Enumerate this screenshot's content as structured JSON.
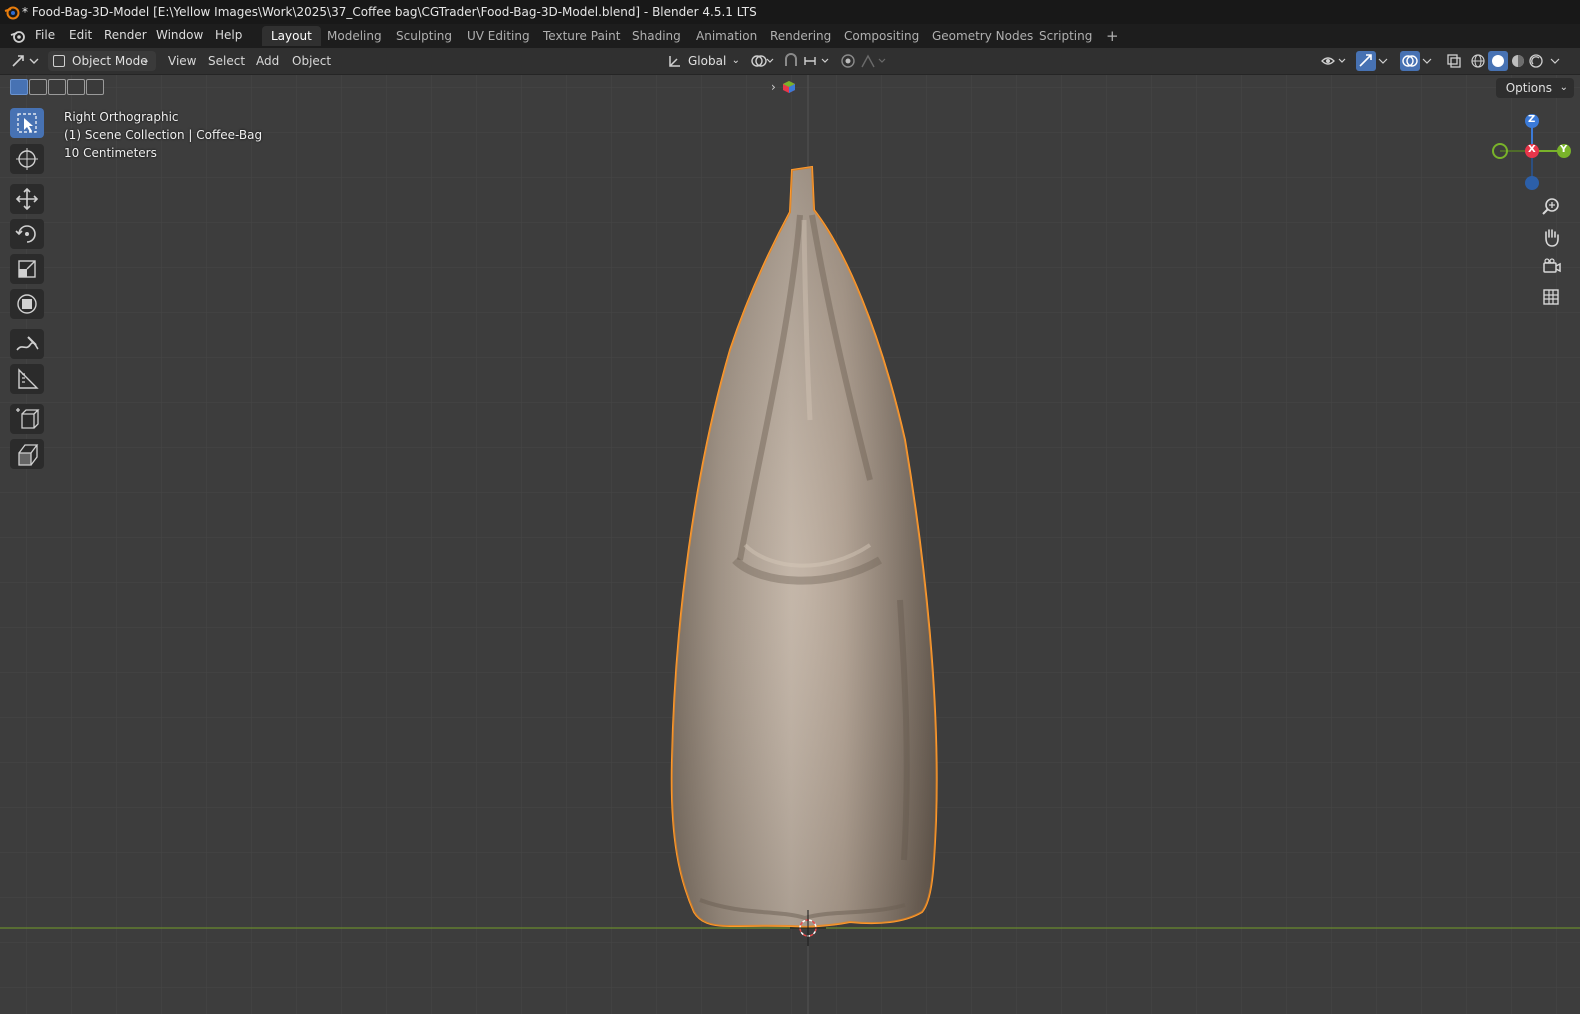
{
  "window": {
    "title": "* Food-Bag-3D-Model [E:\\Yellow Images\\Work\\2025\\37_Coffee bag\\CGTrader\\Food-Bag-3D-Model.blend] - Blender 4.5.1 LTS"
  },
  "menu": {
    "items": [
      "File",
      "Edit",
      "Render",
      "Window",
      "Help"
    ]
  },
  "workspaces": {
    "tabs": [
      "Layout",
      "Modeling",
      "Sculpting",
      "UV Editing",
      "Texture Paint",
      "Shading",
      "Animation",
      "Rendering",
      "Compositing",
      "Geometry Nodes",
      "Scripting"
    ],
    "active": "Layout",
    "add_symbol": "+"
  },
  "header": {
    "mode": "Object Mode",
    "view_menu": [
      "View",
      "Select",
      "Add",
      "Object"
    ],
    "orientation": "Global"
  },
  "viewport": {
    "view_name": "Right Orthographic",
    "collection": "(1) Scene Collection | Coffee-Bag",
    "scale": "10 Centimeters",
    "options_label": "Options",
    "background_color": "#3d3d3d",
    "grid_color": "#474747",
    "floor_line_color": "#6a8a2e",
    "selection_outline_color": "#ff9a2e"
  },
  "gizmo": {
    "axes": {
      "z": "Z",
      "x": "X",
      "y": "Y"
    },
    "colors": {
      "z": "#3b7ad8",
      "x": "#e8364a",
      "y": "#79b32a"
    }
  },
  "toolbar": {
    "tools": [
      "select-box-tool",
      "cursor-tool",
      "move-tool",
      "rotate-tool",
      "scale-tool",
      "transform-tool",
      "annotate-tool",
      "measure-tool",
      "add-cube-tool",
      "extrude-tool"
    ],
    "active_tool": "select-box-tool",
    "accent_color": "#4772b3"
  },
  "nav_icons": [
    "zoom-icon",
    "hand-pan-icon",
    "camera-icon",
    "grid-toggle-icon"
  ]
}
